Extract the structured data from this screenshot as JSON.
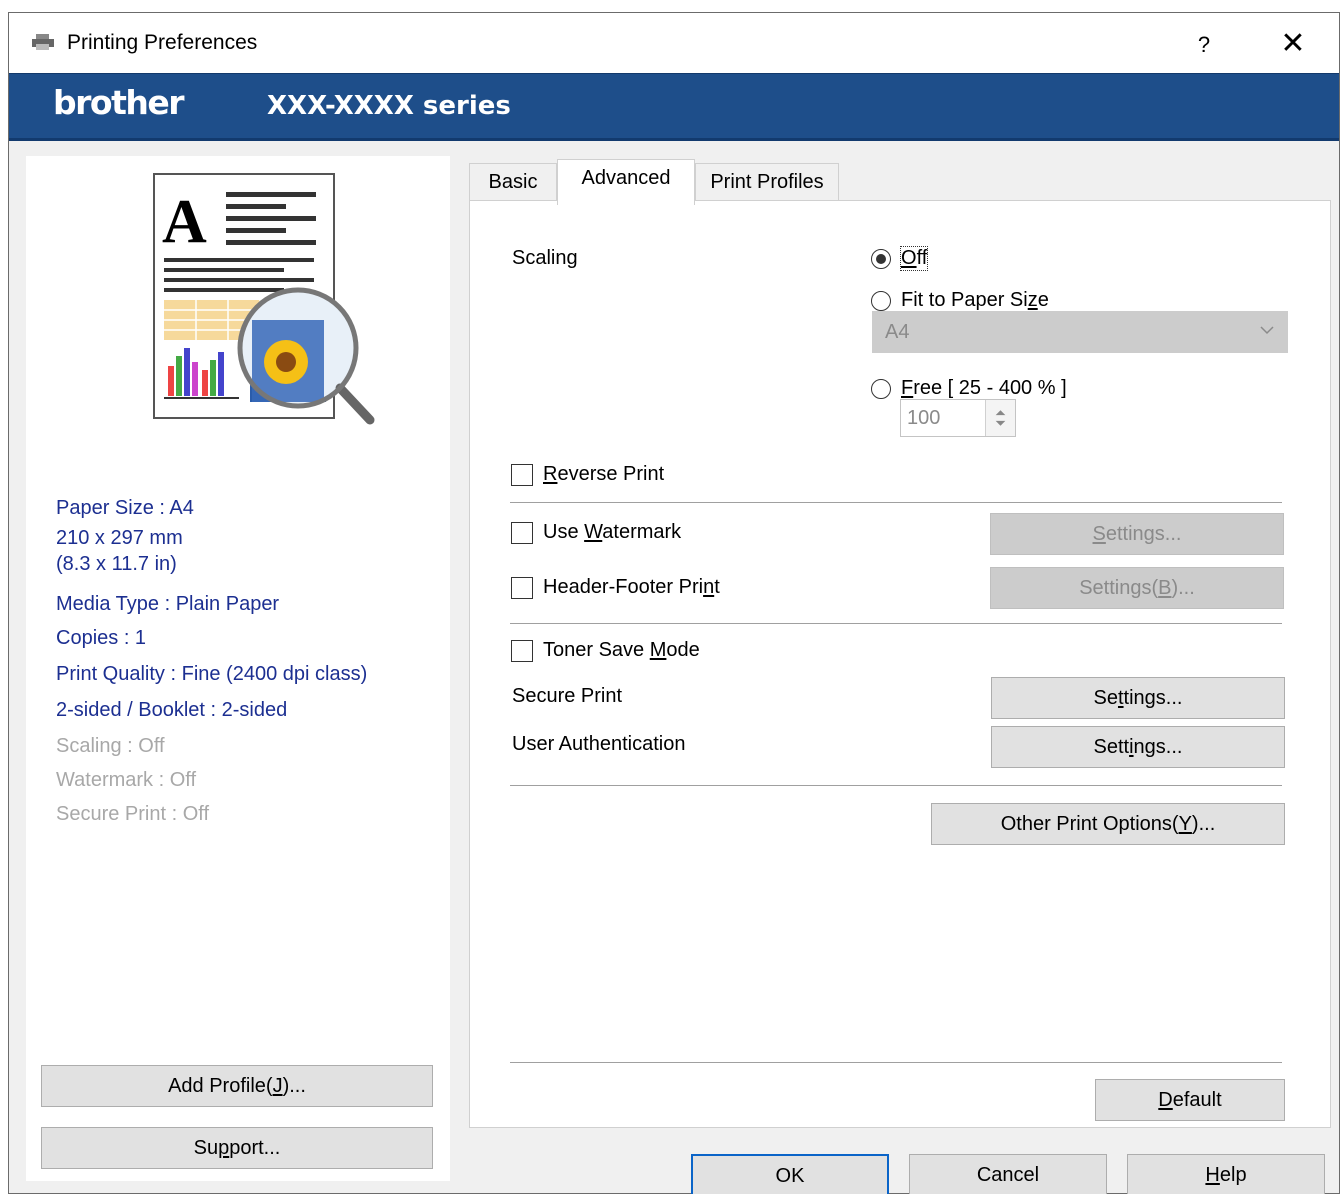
{
  "window": {
    "title": "Printing Preferences",
    "help_glyph": "?",
    "close_glyph": "✕"
  },
  "banner": {
    "logo": "brother",
    "model": "XXX-XXXX series",
    "color": "#1e4e8a"
  },
  "summary": {
    "paper_size": "Paper Size : A4",
    "paper_dims_mm": "210 x 297 mm",
    "paper_dims_in": "(8.3 x 11.7 in)",
    "media_type": "Media Type : Plain Paper",
    "copies": "Copies : 1",
    "print_quality": "Print Quality : Fine (2400 dpi class)",
    "two_sided": "2-sided / Booklet : 2-sided",
    "scaling": "Scaling : Off",
    "watermark": "Watermark : Off",
    "secure_print": "Secure Print : Off"
  },
  "left_buttons": {
    "add_profile": {
      "pre": "Add Profile(",
      "key": "J",
      "post": ")..."
    },
    "support": {
      "pre": "Su",
      "key": "p",
      "post": "port..."
    }
  },
  "tabs": [
    {
      "label": "Basic",
      "selected": false
    },
    {
      "label": "Advanced",
      "selected": true
    },
    {
      "label": "Print Profiles",
      "selected": false
    }
  ],
  "advanced": {
    "scaling_label": "Scaling",
    "scaling_off": {
      "key": "O",
      "post": "ff",
      "selected": true
    },
    "fit_to_paper": {
      "pre": "Fit to Paper Si",
      "key": "z",
      "post": "e",
      "selected": false
    },
    "paper_select_value": "A4",
    "free": {
      "key": "F",
      "post": "ree [ 25 - 400 % ]",
      "selected": false
    },
    "free_value": "100",
    "reverse_print": {
      "key": "R",
      "post": "everse Print",
      "checked": false
    },
    "use_watermark": {
      "pre": "Use ",
      "key": "W",
      "post": "atermark",
      "checked": false
    },
    "watermark_settings": {
      "pre": "",
      "key": "S",
      "post": "ettings..."
    },
    "header_footer": {
      "pre": "Header-Footer Pri",
      "key": "n",
      "post": "t",
      "checked": false
    },
    "header_footer_settings": {
      "pre": "Settings(",
      "key": "B",
      "post": ")..."
    },
    "toner_save": {
      "pre": "Toner Save ",
      "key": "M",
      "post": "ode",
      "checked": false
    },
    "secure_print_label": "Secure Print",
    "secure_print_settings": {
      "pre": "Se",
      "key": "t",
      "post": "tings..."
    },
    "user_auth_label": "User Authentication",
    "user_auth_settings": {
      "pre": "Sett",
      "key": "i",
      "post": "ngs..."
    },
    "other_options": {
      "pre": "Other Print Options(",
      "key": "Y",
      "post": ")..."
    },
    "default_btn": {
      "pre": "",
      "key": "D",
      "post": "efault"
    }
  },
  "dialog_buttons": {
    "ok": "OK",
    "cancel": "Cancel",
    "help": {
      "pre": "",
      "key": "H",
      "post": "elp"
    }
  },
  "icons": [
    "printer-app-icon",
    "document-preview-icon",
    "magnifier-icon",
    "chevron-down-icon",
    "spinner-arrows-icon"
  ]
}
